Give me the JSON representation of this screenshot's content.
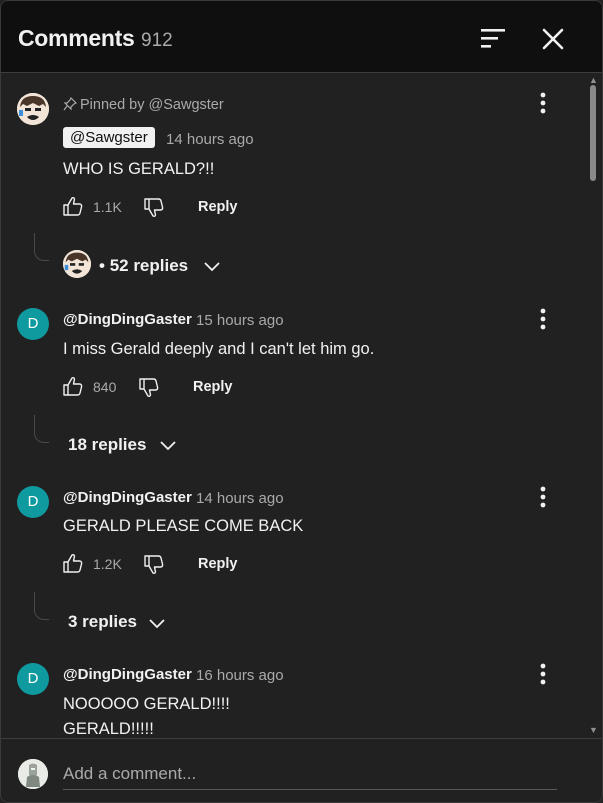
{
  "header": {
    "title": "Comments",
    "count": "912",
    "sort_icon": "sort-icon",
    "close_icon": "close-icon"
  },
  "comments": [
    {
      "pinned_label": "Pinned by @Sawgster",
      "author": "@Sawgster",
      "author_is_creator": true,
      "avatar": "face-avatar",
      "time": "14 hours ago",
      "text": [
        "WHO IS GERALD?!!"
      ],
      "likes": "1.1K",
      "reply_label": "Reply",
      "replies_label": "52 replies",
      "replies_prefix": "•"
    },
    {
      "author": "@DingDingGaster",
      "avatar_letter": "D",
      "time": "15 hours ago",
      "text": [
        "I miss Gerald deeply and I can't let him go."
      ],
      "likes": "840",
      "reply_label": "Reply",
      "replies_label": "18 replies"
    },
    {
      "author": "@DingDingGaster",
      "avatar_letter": "D",
      "time": "14 hours ago",
      "text": [
        "GERALD PLEASE COME BACK"
      ],
      "likes": "1.2K",
      "reply_label": "Reply",
      "replies_label": "3 replies"
    },
    {
      "author": "@DingDingGaster",
      "avatar_letter": "D",
      "time": "16 hours ago",
      "text": [
        "NOOOOO GERALD!!!!",
        "GERALD!!!!!"
      ]
    }
  ],
  "footer": {
    "placeholder": "Add a comment..."
  },
  "colors": {
    "background": "#212121",
    "header_bg": "#0f0f0f",
    "avatar_teal": "#0f9a9f",
    "secondary_text": "#aaaaaa"
  }
}
